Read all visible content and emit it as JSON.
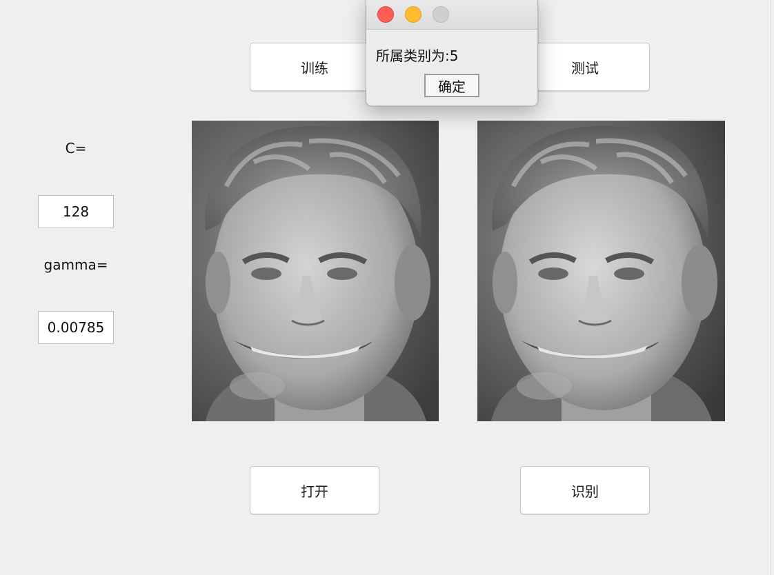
{
  "toolbar": {
    "train_label": "训练",
    "test_label": "测试",
    "open_label": "打开",
    "recognize_label": "识别"
  },
  "params": {
    "c_label": "C=",
    "c_value": "128",
    "gamma_label": "gamma=",
    "gamma_value": "0.00785"
  },
  "images": {
    "query_face": "grayscale-face-photo",
    "matched_face": "grayscale-face-photo"
  },
  "dialog": {
    "message": "所属类别为:5",
    "ok_label": "确定",
    "controls": [
      "close",
      "minimize",
      "zoom"
    ]
  },
  "colors": {
    "background": "#efefef",
    "close": "#fd5f57",
    "minimize": "#febc2e",
    "zoom_disabled": "#cfcfcf"
  }
}
